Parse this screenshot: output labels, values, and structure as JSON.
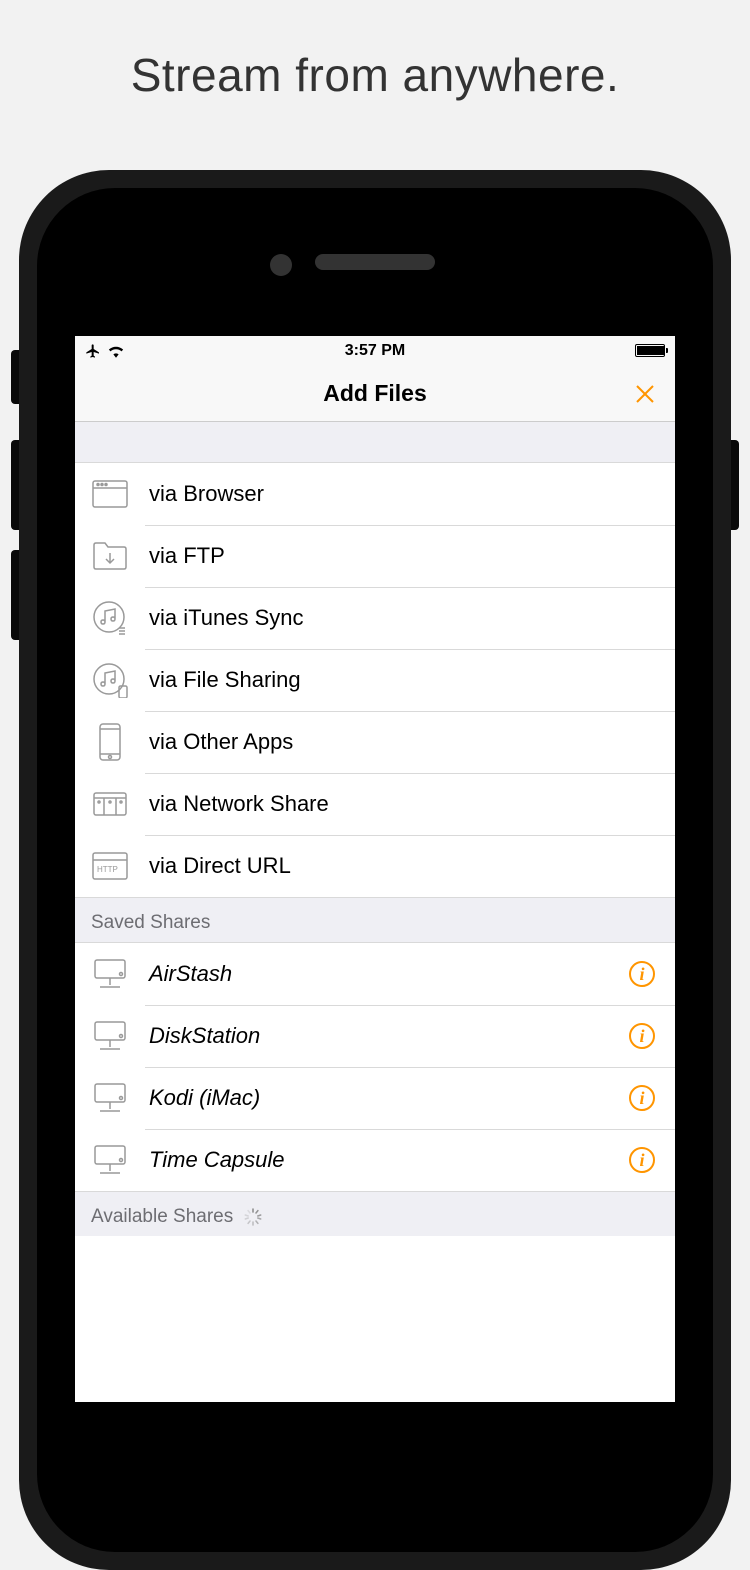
{
  "promo_title": "Stream from anywhere.",
  "status_bar": {
    "time": "3:57 PM"
  },
  "nav": {
    "title": "Add Files"
  },
  "methods": [
    {
      "label": "via Browser",
      "icon": "browser-window-icon"
    },
    {
      "label": "via FTP",
      "icon": "folder-download-icon"
    },
    {
      "label": "via iTunes Sync",
      "icon": "music-sync-icon"
    },
    {
      "label": "via File Sharing",
      "icon": "music-device-icon"
    },
    {
      "label": "via Other Apps",
      "icon": "phone-icon"
    },
    {
      "label": "via Network Share",
      "icon": "network-drive-icon"
    },
    {
      "label": "via Direct URL",
      "icon": "http-window-icon"
    }
  ],
  "saved_header": "Saved Shares",
  "saved_shares": [
    {
      "label": "AirStash",
      "icon": "drive-stand-icon"
    },
    {
      "label": "DiskStation",
      "icon": "drive-stand-icon"
    },
    {
      "label": "Kodi (iMac)",
      "icon": "drive-stand-icon"
    },
    {
      "label": "Time Capsule",
      "icon": "drive-stand-icon"
    }
  ],
  "available_header": "Available Shares",
  "accent_color": "#ff9500"
}
